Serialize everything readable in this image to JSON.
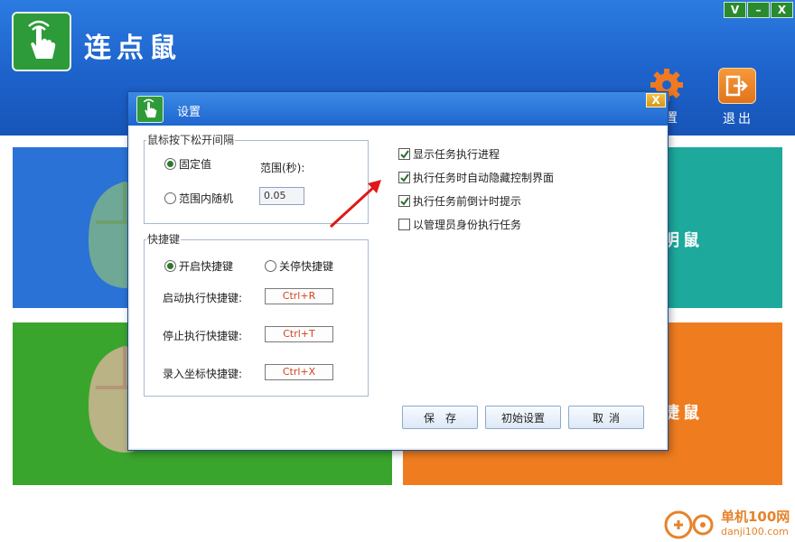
{
  "app": {
    "title": "连点鼠",
    "window_controls": [
      "V",
      "–",
      "X"
    ],
    "tools": {
      "settings_label_partial": "置",
      "exit_label": "退出"
    },
    "tiles": {
      "teal_label_partial": "明鼠",
      "orange_label_partial": "捷鼠"
    },
    "watermark": {
      "name": "单机100网",
      "url": "danji100.com"
    }
  },
  "dialog": {
    "title": "设置",
    "close_label": "X",
    "interval_group": {
      "legend": "鼠标按下松开间隔",
      "fixed_label": "固定值",
      "fixed_selected": true,
      "range_label": "范围(秒):",
      "random_label": "范围内随机",
      "random_selected": false,
      "range_value": "0.05"
    },
    "hotkey_group": {
      "legend": "快捷键",
      "enable_label": "开启快捷键",
      "enable_selected": true,
      "disable_label": "关停快捷键",
      "disable_selected": false,
      "start_label": "启动执行快捷键:",
      "start_key": "Ctrl+R",
      "stop_label": "停止执行快捷键:",
      "stop_key": "Ctrl+T",
      "record_label": "录入坐标快捷键:",
      "record_key": "Ctrl+X"
    },
    "options": [
      {
        "label": "显示任务执行进程",
        "checked": true
      },
      {
        "label": "执行任务时自动隐藏控制界面",
        "checked": true
      },
      {
        "label": "执行任务前倒计时提示",
        "checked": true
      },
      {
        "label": "以管理员身份执行任务",
        "checked": false
      }
    ],
    "buttons": {
      "save": "保存",
      "reset": "初始设置",
      "cancel": "取消"
    }
  },
  "colors": {
    "header_blue": "#1d62cb",
    "tile_blue": "#2a72d6",
    "tile_teal": "#1da99c",
    "tile_green": "#3aa52c",
    "tile_orange": "#ef7d20",
    "hotkey_text": "#d0451f",
    "annotation_arrow": "#e01818"
  }
}
